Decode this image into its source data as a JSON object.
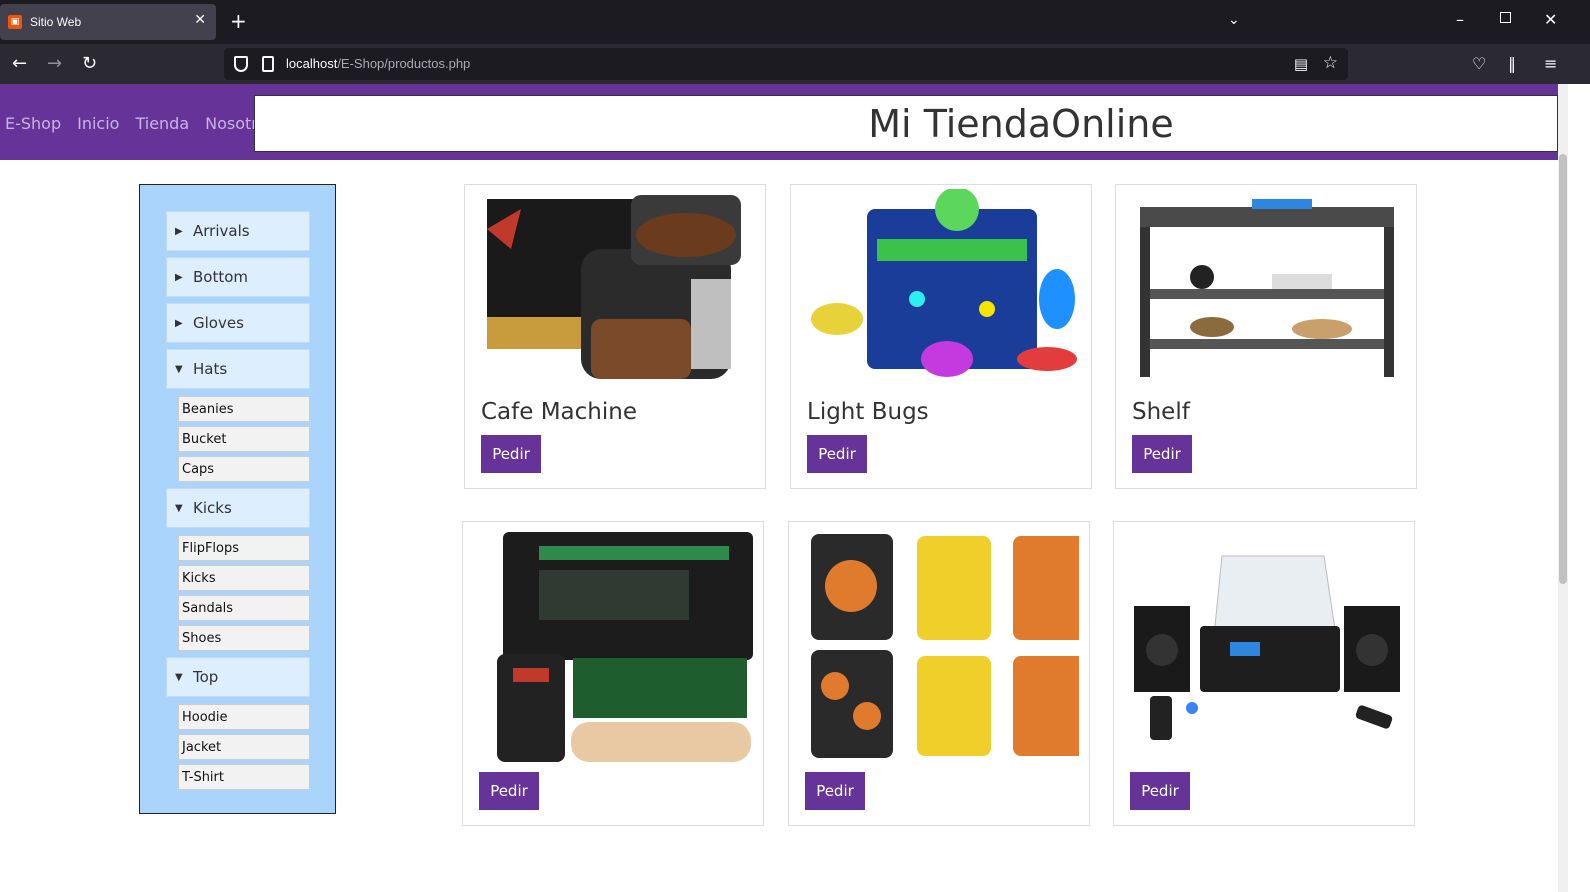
{
  "browser": {
    "tab_title": "Sitio Web",
    "url_host": "localhost",
    "url_path": "/E-Shop/productos.php"
  },
  "site": {
    "nav": [
      "E-Shop",
      "Inicio",
      "Tienda",
      "Nosotros"
    ],
    "title": "Mi TiendaOnline"
  },
  "sidebar": {
    "categories": [
      {
        "label": "Arrivals",
        "expanded": false,
        "items": []
      },
      {
        "label": "Bottom",
        "expanded": false,
        "items": []
      },
      {
        "label": "Gloves",
        "expanded": false,
        "items": []
      },
      {
        "label": "Hats",
        "expanded": true,
        "items": [
          "Beanies",
          "Bucket",
          "Caps"
        ]
      },
      {
        "label": "Kicks",
        "expanded": true,
        "items": [
          "FlipFlops",
          "Kicks",
          "Sandals",
          "Shoes"
        ]
      },
      {
        "label": "Top",
        "expanded": true,
        "items": [
          "Hoodie",
          "Jacket",
          "T-Shirt"
        ]
      }
    ]
  },
  "products": [
    {
      "name": "Cafe Machine",
      "button": "Pedir"
    },
    {
      "name": "Light Bugs",
      "button": "Pedir"
    },
    {
      "name": "Shelf",
      "button": "Pedir"
    },
    {
      "name": "",
      "button": "Pedir"
    },
    {
      "name": "",
      "button": "Pedir"
    },
    {
      "name": "",
      "button": "Pedir"
    }
  ],
  "colors": {
    "brand": "#663399",
    "sidebar_bg": "#abd4fd",
    "category_bg": "#ddeefe"
  }
}
